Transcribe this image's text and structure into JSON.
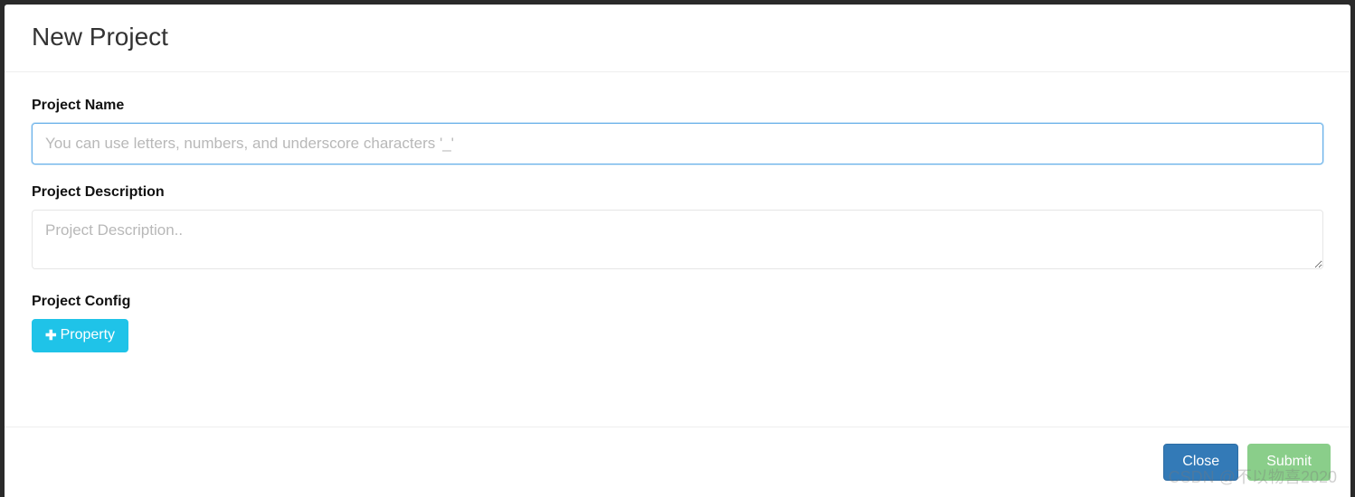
{
  "modal": {
    "title": "New Project"
  },
  "form": {
    "projectName": {
      "label": "Project Name",
      "placeholder": "You can use letters, numbers, and underscore characters '_'",
      "value": ""
    },
    "projectDescription": {
      "label": "Project Description",
      "placeholder": "Project Description..",
      "value": ""
    },
    "projectConfig": {
      "label": "Project Config",
      "addButtonLabel": "Property"
    }
  },
  "footer": {
    "closeLabel": "Close",
    "submitLabel": "Submit"
  },
  "watermark": "CSDN @不以物喜2020"
}
